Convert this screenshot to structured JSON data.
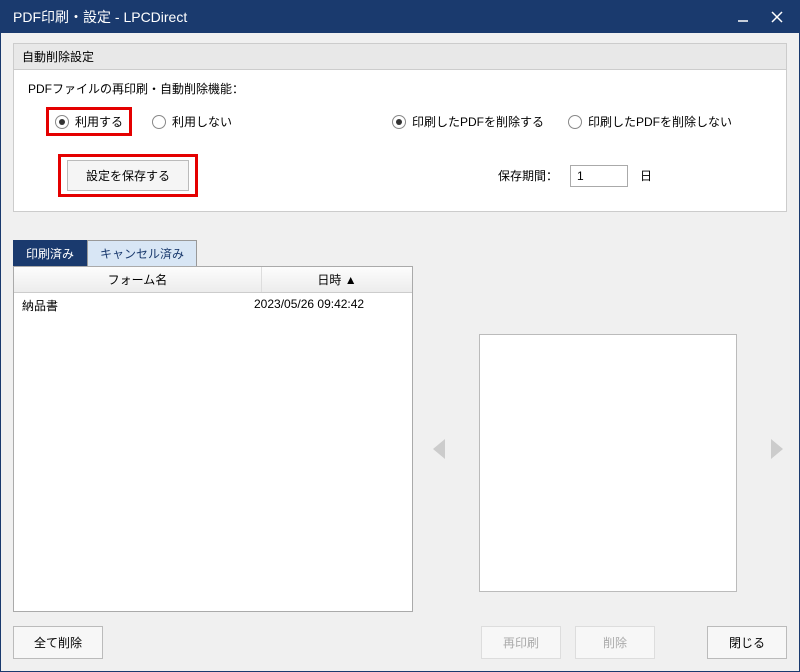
{
  "window": {
    "title": "PDF印刷・設定 - LPCDirect"
  },
  "settings": {
    "header": "自動削除設定",
    "subtitle": "PDFファイルの再印刷・自動削除機能：",
    "use_radio": {
      "use": "利用する",
      "dontuse": "利用しない"
    },
    "delete_radio": {
      "delete": "印刷したPDFを削除する",
      "keep": "印刷したPDFを削除しない"
    },
    "save_button": "設定を保存する",
    "retention_label": "保存期間：",
    "retention_value": "1",
    "retention_unit": "日"
  },
  "tabs": {
    "printed": "印刷済み",
    "cancelled": "キャンセル済み"
  },
  "list": {
    "col_form": "フォーム名",
    "col_date": "日時 ▲",
    "rows": [
      {
        "form": "納品書",
        "date": "2023/05/26 09:42:42"
      }
    ]
  },
  "buttons": {
    "delete_all": "全て削除",
    "reprint": "再印刷",
    "delete": "削除",
    "close": "閉じる"
  }
}
